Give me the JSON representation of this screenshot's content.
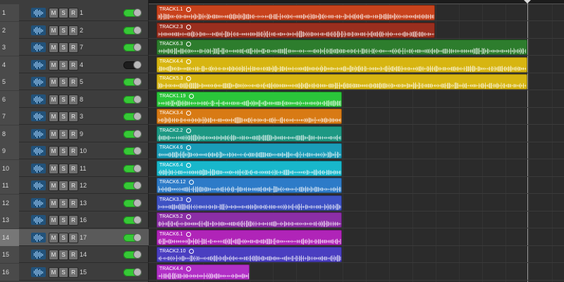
{
  "colors": {
    "red": "#c8421c",
    "brown": "#9a2e1e",
    "green": "#2d7d2d",
    "yellow": "#d7b511",
    "bright_green": "#2ac53a",
    "orange": "#d87a14",
    "teal": "#1d9883",
    "cyan_blue": "#1a9cb8",
    "cyan": "#18b7cb",
    "blue": "#2d7bc8",
    "indigo": "#3e52c4",
    "purple": "#7a36b4",
    "violet": "#8c2ea6",
    "magenta": "#b024b8",
    "blue_violet": "#4a3ec0",
    "pink_purple": "#b12fc6",
    "toggle_on": "#36c936"
  },
  "tracks": [
    {
      "number": "1",
      "name": "1",
      "mute": "M",
      "solo": "S",
      "record": "R",
      "icon": "waveform-icon",
      "enabled": true,
      "selected": false
    },
    {
      "number": "2",
      "name": "2",
      "mute": "M",
      "solo": "S",
      "record": "R",
      "icon": "waveform-icon",
      "enabled": true,
      "selected": false
    },
    {
      "number": "3",
      "name": "7",
      "mute": "M",
      "solo": "S",
      "record": "R",
      "icon": "waveform-icon",
      "enabled": true,
      "selected": false
    },
    {
      "number": "4",
      "name": "4",
      "mute": "M",
      "solo": "S",
      "record": "R",
      "icon": "waveform-icon",
      "enabled": false,
      "selected": false
    },
    {
      "number": "5",
      "name": "5",
      "mute": "M",
      "solo": "S",
      "record": "R",
      "icon": "waveform-icon",
      "enabled": true,
      "selected": false
    },
    {
      "number": "6",
      "name": "8",
      "mute": "M",
      "solo": "S",
      "record": "R",
      "icon": "waveform-icon",
      "enabled": true,
      "selected": false
    },
    {
      "number": "7",
      "name": "3",
      "mute": "M",
      "solo": "S",
      "record": "R",
      "icon": "waveform-icon",
      "enabled": true,
      "selected": false
    },
    {
      "number": "8",
      "name": "9",
      "mute": "M",
      "solo": "S",
      "record": "R",
      "icon": "waveform-icon",
      "enabled": true,
      "selected": false
    },
    {
      "number": "9",
      "name": "10",
      "mute": "M",
      "solo": "S",
      "record": "R",
      "icon": "waveform-icon",
      "enabled": true,
      "selected": false
    },
    {
      "number": "10",
      "name": "11",
      "mute": "M",
      "solo": "S",
      "record": "R",
      "icon": "waveform-icon",
      "enabled": true,
      "selected": false
    },
    {
      "number": "11",
      "name": "12",
      "mute": "M",
      "solo": "S",
      "record": "R",
      "icon": "waveform-icon",
      "enabled": true,
      "selected": false
    },
    {
      "number": "12",
      "name": "13",
      "mute": "M",
      "solo": "S",
      "record": "R",
      "icon": "waveform-icon",
      "enabled": true,
      "selected": false
    },
    {
      "number": "13",
      "name": "16",
      "mute": "M",
      "solo": "S",
      "record": "R",
      "icon": "waveform-icon",
      "enabled": true,
      "selected": false
    },
    {
      "number": "14",
      "name": "17",
      "mute": "M",
      "solo": "S",
      "record": "R",
      "icon": "waveform-icon",
      "enabled": true,
      "selected": true
    },
    {
      "number": "15",
      "name": "14",
      "mute": "M",
      "solo": "S",
      "record": "R",
      "icon": "waveform-icon",
      "enabled": true,
      "selected": false
    },
    {
      "number": "16",
      "name": "15",
      "mute": "M",
      "solo": "S",
      "record": "R",
      "icon": "waveform-icon",
      "enabled": true,
      "selected": false
    }
  ],
  "regions": [
    {
      "name": "TRACK1.1",
      "color": "red",
      "loop_icon": "loop-icon"
    },
    {
      "name": "TRACK2.3",
      "color": "brown",
      "loop_icon": "loop-icon"
    },
    {
      "name": "TRACK6.3",
      "color": "green",
      "loop_icon": "loop-icon"
    },
    {
      "name": "TRACK4.4",
      "color": "yellow",
      "loop_icon": "loop-icon"
    },
    {
      "name": "TRACK5.3",
      "color": "yellow",
      "loop_icon": "loop-icon"
    },
    {
      "name": "TRACK1.19",
      "color": "bright_green",
      "loop_icon": "loop-icon"
    },
    {
      "name": "TRACK3.4",
      "color": "orange",
      "loop_icon": "loop-icon"
    },
    {
      "name": "TRACK2.2",
      "color": "teal",
      "loop_icon": "loop-icon"
    },
    {
      "name": "TRACK4.6",
      "color": "cyan_blue",
      "loop_icon": "loop-icon"
    },
    {
      "name": "TRACK6.4",
      "color": "cyan",
      "loop_icon": "loop-icon"
    },
    {
      "name": "TRACK6.12",
      "color": "blue",
      "loop_icon": "loop-icon"
    },
    {
      "name": "TRACK3.3",
      "color": "indigo",
      "loop_icon": "loop-icon"
    },
    {
      "name": "TRACK5.2",
      "color": "violet",
      "loop_icon": "loop-icon"
    },
    {
      "name": "TRACK6.1",
      "color": "magenta",
      "loop_icon": "loop-icon"
    },
    {
      "name": "TRACK2.10",
      "color": "blue_violet",
      "loop_icon": "loop-icon"
    },
    {
      "name": "TRACK4.4",
      "color": "pink_purple",
      "loop_icon": "loop-icon"
    }
  ]
}
